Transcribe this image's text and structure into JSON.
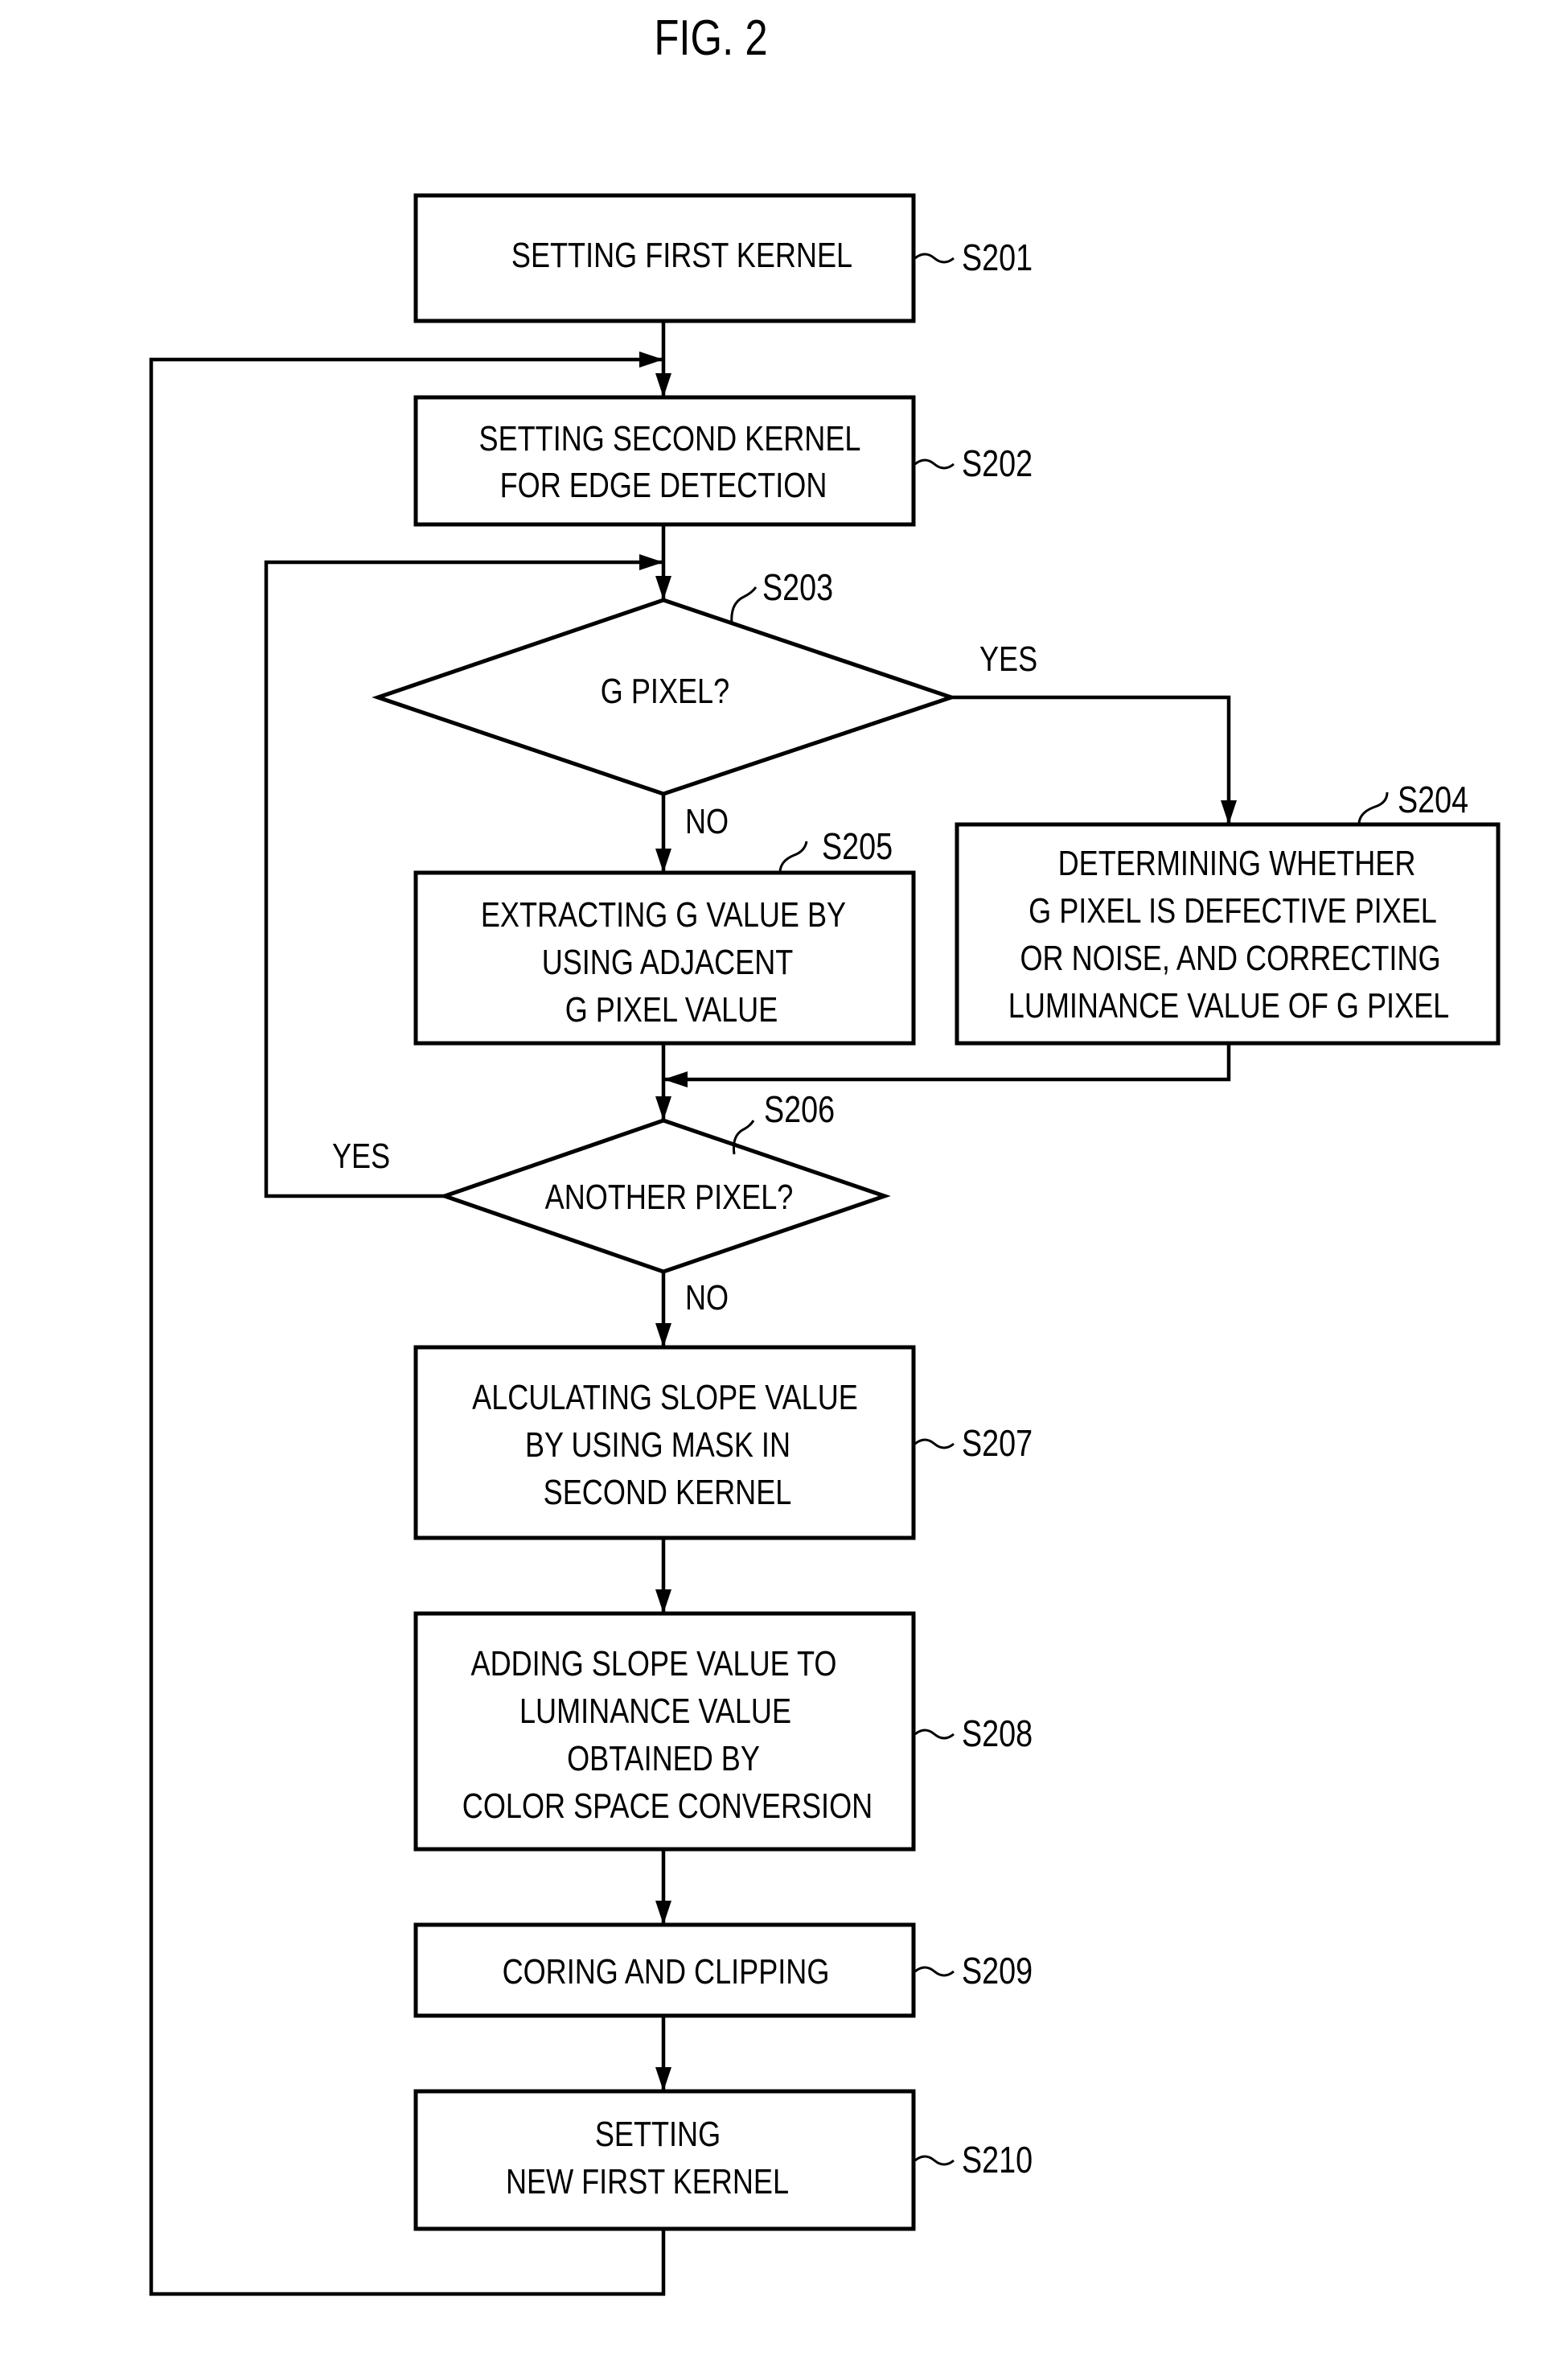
{
  "figure": {
    "title": "FIG. 2"
  },
  "steps": {
    "s201": {
      "ref": "S201",
      "lines": [
        "SETTING FIRST KERNEL"
      ]
    },
    "s202": {
      "ref": "S202",
      "lines": [
        "SETTING SECOND KERNEL",
        "FOR EDGE DETECTION"
      ]
    },
    "s203": {
      "ref": "S203",
      "lines": [
        "G PIXEL?"
      ],
      "yes": "YES",
      "no": "NO"
    },
    "s204": {
      "ref": "S204",
      "lines": [
        "DETERMINING WHETHER",
        "G PIXEL IS DEFECTIVE PIXEL",
        "OR NOISE, AND CORRECTING",
        "LUMINANCE VALUE OF G PIXEL"
      ]
    },
    "s205": {
      "ref": "S205",
      "lines": [
        "EXTRACTING G VALUE BY",
        "USING ADJACENT",
        "G PIXEL VALUE"
      ]
    },
    "s206": {
      "ref": "S206",
      "lines": [
        "ANOTHER PIXEL?"
      ],
      "yes": "YES",
      "no": "NO"
    },
    "s207": {
      "ref": "S207",
      "lines": [
        "ALCULATING SLOPE VALUE",
        "BY USING MASK IN",
        "SECOND KERNEL"
      ]
    },
    "s208": {
      "ref": "S208",
      "lines": [
        "ADDING SLOPE VALUE TO",
        "LUMINANCE VALUE",
        "OBTAINED BY",
        "COLOR SPACE CONVERSION"
      ]
    },
    "s209": {
      "ref": "S209",
      "lines": [
        "CORING AND CLIPPING"
      ]
    },
    "s210": {
      "ref": "S210",
      "lines": [
        "SETTING",
        "NEW FIRST KERNEL"
      ]
    }
  }
}
